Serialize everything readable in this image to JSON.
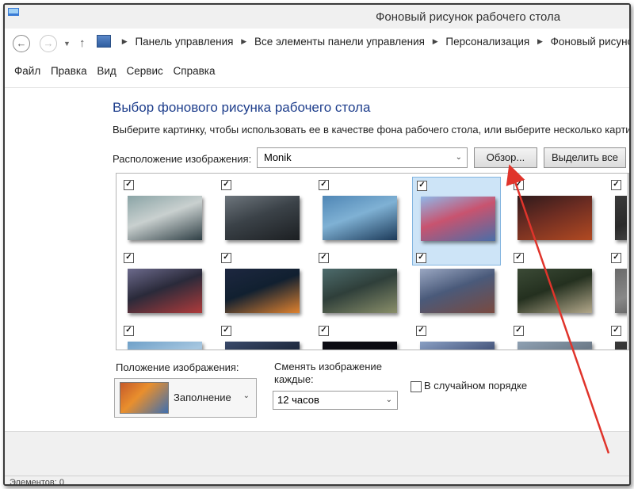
{
  "window": {
    "title": "Фоновый рисунок рабочего стола"
  },
  "address": {
    "breadcrumbs": [
      "Панель управления",
      "Все элементы панели управления",
      "Персонализация",
      "Фоновый рисунок рабочего стола"
    ]
  },
  "menu": {
    "items": [
      "Файл",
      "Правка",
      "Вид",
      "Сервис",
      "Справка"
    ]
  },
  "content": {
    "heading": "Выбор фонового рисунка рабочего стола",
    "subtitle": "Выберите картинку, чтобы использовать ее в качестве фона рабочего стола, или выберите несколько картинок",
    "location_label": "Расположение изображения:",
    "location_value": "Monik",
    "browse_label": "Обзор...",
    "select_all_label": "Выделить все"
  },
  "gallery": {
    "thumbnails": [
      {
        "checked": true,
        "colors": [
          "#8aa4a6",
          "#2f3f45",
          "#c9d0cf"
        ]
      },
      {
        "checked": true,
        "colors": [
          "#6d757c",
          "#1c1f22",
          "#3b4248"
        ]
      },
      {
        "checked": true,
        "colors": [
          "#4f86b5",
          "#1c3a59",
          "#7fb1d4"
        ]
      },
      {
        "checked": true,
        "selected": true,
        "colors": [
          "#8fb7e8",
          "#4a6ea8",
          "#c8536f"
        ]
      },
      {
        "checked": true,
        "colors": [
          "#2e1a1c",
          "#b24a22",
          "#6e2d22"
        ]
      },
      {
        "checked": true,
        "colors": [
          "#3a3a3a",
          "#5b5b5b",
          "#2a2a2a"
        ]
      },
      {
        "checked": true,
        "colors": [
          "#6c6a8c",
          "#b03b3b",
          "#2a2a3a"
        ]
      },
      {
        "checked": true,
        "colors": [
          "#1d2740",
          "#e0822f",
          "#112030"
        ]
      },
      {
        "checked": true,
        "colors": [
          "#4d6b6c",
          "#8a8f6a",
          "#2f3f3a"
        ]
      },
      {
        "checked": true,
        "colors": [
          "#9aa7c2",
          "#7a4a40",
          "#4a5a7a"
        ]
      },
      {
        "checked": true,
        "colors": [
          "#3b4a36",
          "#b3a88b",
          "#24301f"
        ]
      },
      {
        "checked": true,
        "colors": [
          "#6a6a6a",
          "#444",
          "#888"
        ]
      },
      {
        "checked": true,
        "colors": [
          "#6fa0c8",
          "#2f5f8e",
          "#a7c7e0"
        ]
      },
      {
        "checked": true,
        "colors": [
          "#3a4a6a",
          "#6c8ab0",
          "#1f2a3f"
        ]
      },
      {
        "checked": true,
        "colors": [
          "#0d0d14",
          "#1c2a4a",
          "#0a0a10"
        ]
      },
      {
        "checked": true,
        "colors": [
          "#8aa0c4",
          "#c2a07a",
          "#4a5a80"
        ]
      },
      {
        "checked": true,
        "colors": [
          "#8fa1b3",
          "#d9dde2",
          "#6c7a88"
        ]
      },
      {
        "checked": true,
        "colors": [
          "#3a3a3a",
          "#5a5a5a",
          "#2a2a2a"
        ]
      }
    ]
  },
  "settings": {
    "position_label": "Положение изображения:",
    "position_value": "Заполнение",
    "interval_label": "Сменять изображение каждые:",
    "interval_value": "12 часов",
    "shuffle_label": "В случайном порядке",
    "shuffle_checked": false
  },
  "status": {
    "text": "Элементов: 0"
  },
  "colors": {
    "accent": "#1e3e8c",
    "arrow": "#e0342b",
    "selection": "#cde4f7"
  }
}
